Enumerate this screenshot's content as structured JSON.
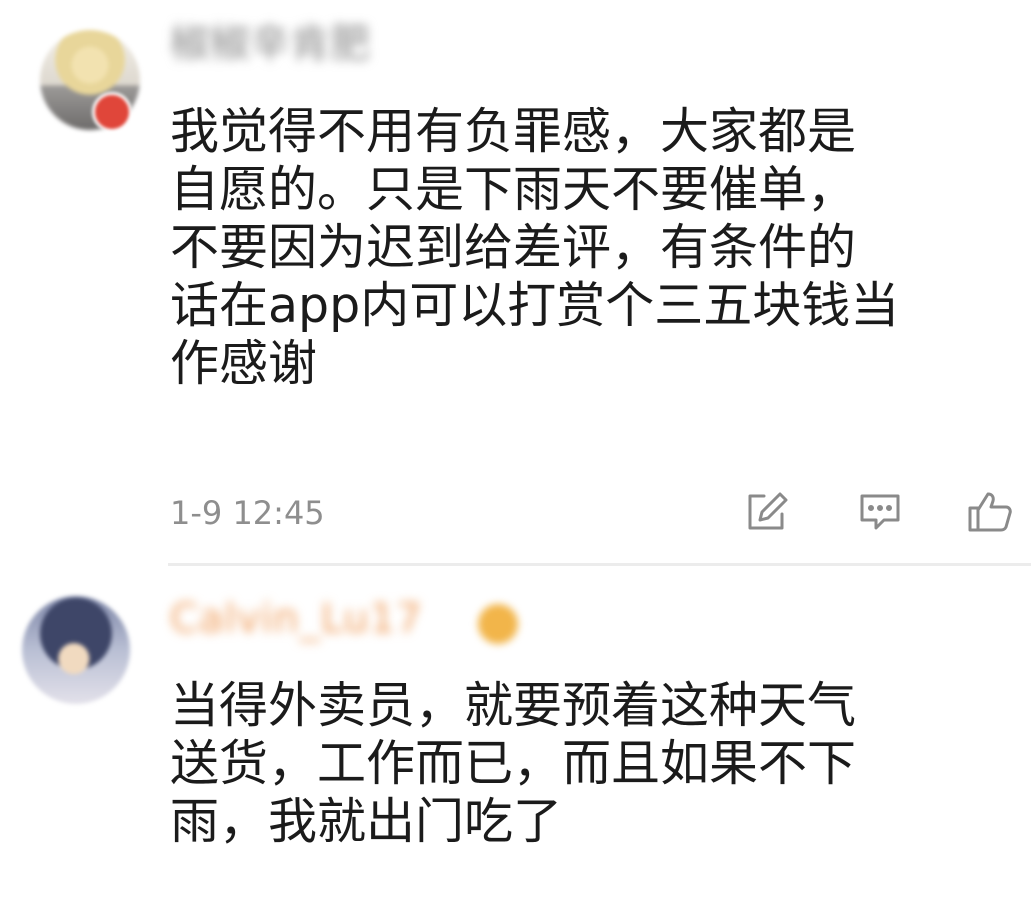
{
  "comments": [
    {
      "username": "椒椒辛肯肥",
      "text": "我觉得不用有负罪感，大家都是\n自愿的。只是下雨天不要催单，\n不要因为迟到给差评，有条件的\n话在app内可以打赏个三五块钱当\n作感谢",
      "timestamp": "1-9 12:45",
      "icons": [
        "share-icon",
        "reply-icon",
        "like-icon"
      ]
    },
    {
      "username": "Calvin_Lu17",
      "text": "当得外卖员，就要预着这种天气\n送货，工作而已，而且如果不下\n雨，我就出门吃了"
    }
  ],
  "colors": {
    "text": "#1b1b1b",
    "meta": "#8e8e8e",
    "icon": "#8a8a8a",
    "divider": "#ececec"
  }
}
